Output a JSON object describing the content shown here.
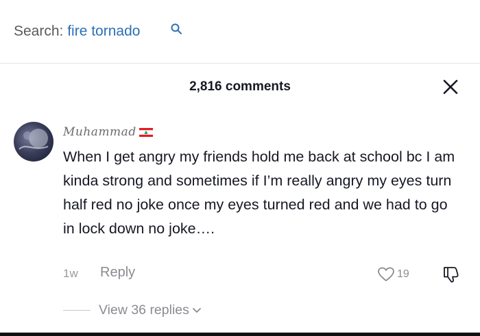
{
  "search": {
    "prefix": "Search: ",
    "query": "fire tornado",
    "icon": "search-icon"
  },
  "comments_panel": {
    "count_label": "2,816 comments",
    "close_icon": "close-icon"
  },
  "comment": {
    "username": "Muhammad",
    "flag_icon": "lebanon-flag-icon",
    "text": "When I get angry my friends hold me back at school bc I am kinda strong and sometimes if I’m really angry my eyes turn half red no joke once my eyes turned red and we had to go in lock down no joke….",
    "time": "1w",
    "reply_label": "Reply",
    "likes": "19",
    "view_replies_label": "View 36 replies"
  },
  "colors": {
    "text": "#161823",
    "muted": "#8a8b91",
    "link": "#2b6fb6",
    "flag_red": "#e31b23",
    "flag_green": "#00a651"
  }
}
